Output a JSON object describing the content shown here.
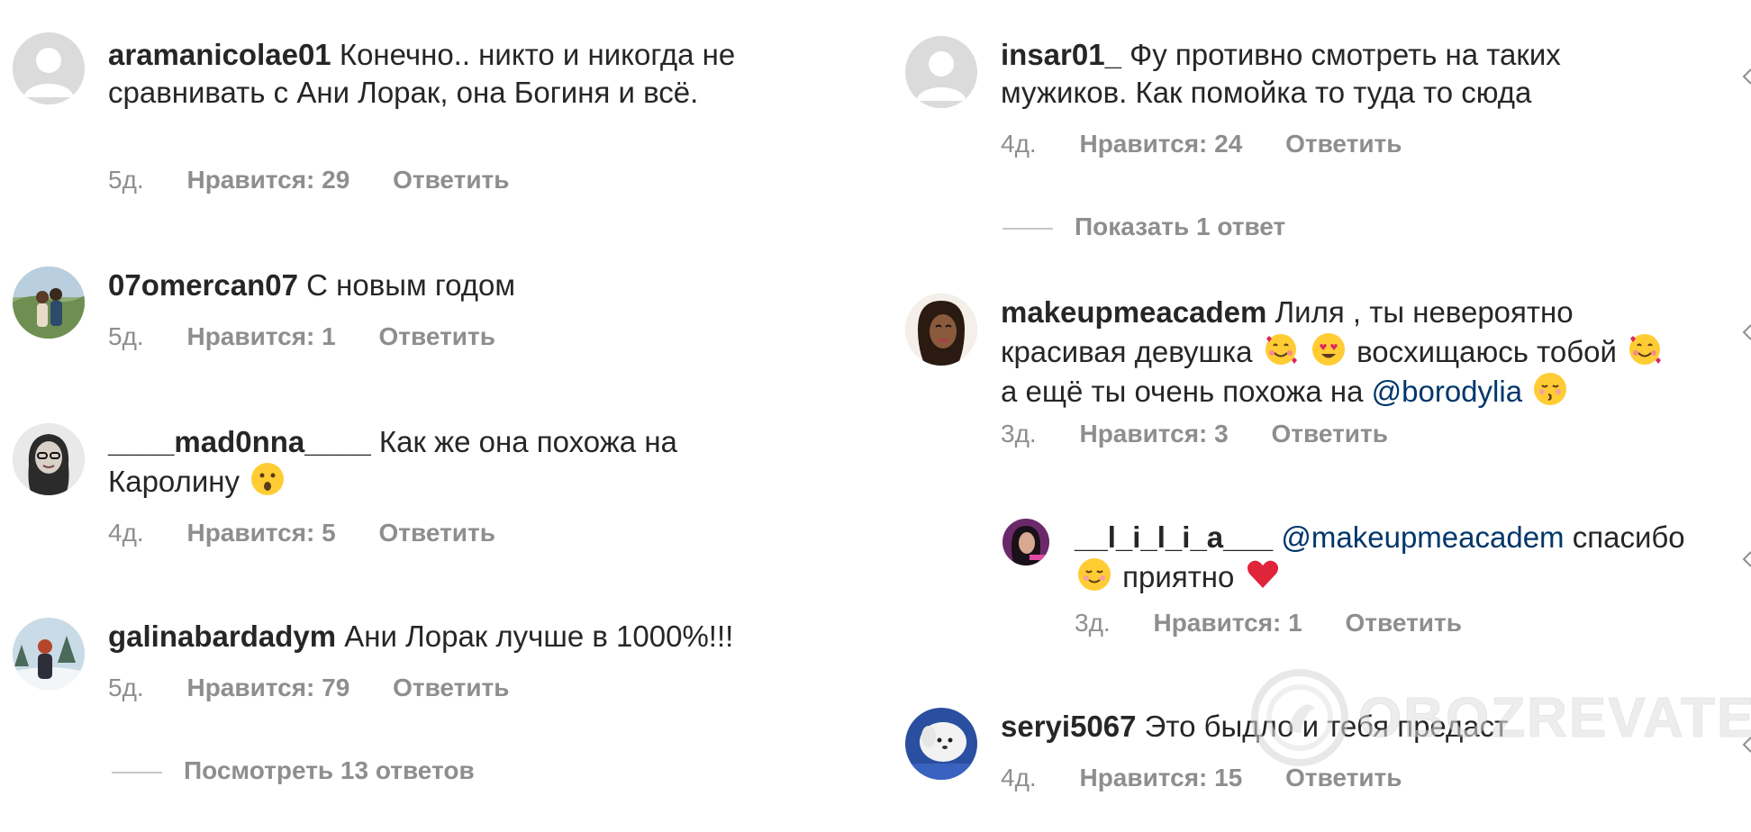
{
  "left": {
    "comments": [
      {
        "username": "aramanicolae01",
        "text": "Конечно.. никто и никогда не сравнивать с Ани Лорак, она Богиня и всё.",
        "time": "5д.",
        "likes": "Нравится: 29",
        "reply": "Ответить"
      },
      {
        "username": "07omercan07",
        "text": "С новым годом",
        "time": "5д.",
        "likes": "Нравится: 1",
        "reply": "Ответить"
      },
      {
        "username": "____mad0nna____",
        "text_before": "Как же она похожа на Каролину",
        "emoji": "hushed-face-emoji",
        "time": "4д.",
        "likes": "Нравится: 5",
        "reply": "Ответить"
      },
      {
        "username": "galinabardadym",
        "text": "Ани Лорак лучше в 1000%!!!",
        "time": "5д.",
        "likes": "Нравится: 79",
        "reply": "Ответить"
      }
    ],
    "view_replies": "Посмотреть 13 ответов"
  },
  "right": {
    "comments": [
      {
        "username": "insar01_",
        "text": "Фу противно смотреть на таких мужиков. Как помойка то туда то сюда",
        "time": "4д.",
        "likes": "Нравится: 24",
        "reply": "Ответить"
      },
      {
        "username": "makeupmeacadem",
        "text_part1": "Лиля , ты невероятно красивая девушка",
        "text_part2": "восхищаюсь тобой",
        "text_part3": "а ещё ты очень похожа на",
        "mention": "@borodylia",
        "emojis": [
          "smiling-face-with-hearts-emoji",
          "heart-eyes-emoji",
          "kissing-closed-eyes-emoji"
        ],
        "time": "3д.",
        "likes": "Нравится: 3",
        "reply": "Ответить"
      },
      {
        "username": "seryi5067",
        "text": "Это быдло и тебя предаст",
        "time": "4д.",
        "likes": "Нравится: 15",
        "reply": "Ответить"
      }
    ],
    "show_reply": "Показать 1 ответ",
    "nested_reply": {
      "username": "__l_i_l_i_a___",
      "mention": "@makeupmeacadem",
      "text_part1": "спасибо",
      "text_part2": "приятно",
      "emojis": [
        "smiling-blush-emoji",
        "red-heart-emoji"
      ],
      "time": "3д.",
      "likes": "Нравится: 1",
      "reply": "Ответить"
    }
  },
  "watermark": {
    "text": "OBOZREVATEL"
  },
  "colors": {
    "meta_gray": "#8e8e8e",
    "text": "#262626",
    "mention": "#00376b",
    "placeholder_avatar": "#dbdbdb"
  }
}
